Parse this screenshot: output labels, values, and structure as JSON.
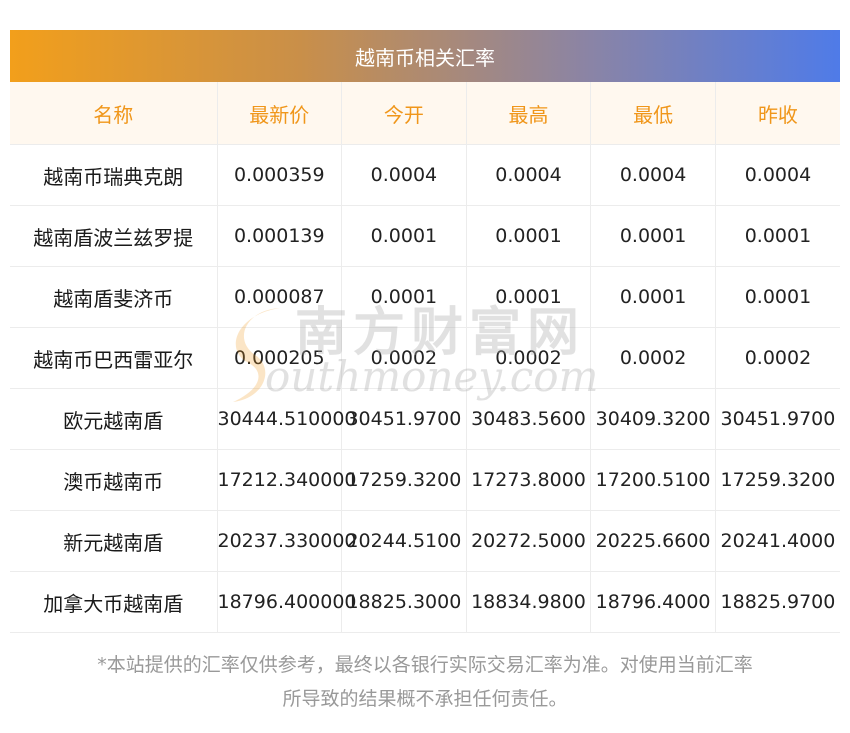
{
  "title": "越南币相关汇率",
  "columns": [
    "名称",
    "最新价",
    "今开",
    "最高",
    "最低",
    "昨收"
  ],
  "rows": [
    [
      "越南币瑞典克朗",
      "0.000359",
      "0.0004",
      "0.0004",
      "0.0004",
      "0.0004"
    ],
    [
      "越南盾波兰兹罗提",
      "0.000139",
      "0.0001",
      "0.0001",
      "0.0001",
      "0.0001"
    ],
    [
      "越南盾斐济币",
      "0.000087",
      "0.0001",
      "0.0001",
      "0.0001",
      "0.0001"
    ],
    [
      "越南币巴西雷亚尔",
      "0.000205",
      "0.0002",
      "0.0002",
      "0.0002",
      "0.0002"
    ],
    [
      "欧元越南盾",
      "30444.510000",
      "30451.9700",
      "30483.5600",
      "30409.3200",
      "30451.9700"
    ],
    [
      "澳币越南币",
      "17212.340000",
      "17259.3200",
      "17273.8000",
      "17200.5100",
      "17259.3200"
    ],
    [
      "新元越南盾",
      "20237.330000",
      "20244.5100",
      "20272.5000",
      "20225.6600",
      "20241.4000"
    ],
    [
      "加拿大币越南盾",
      "18796.400000",
      "18825.3000",
      "18834.9800",
      "18796.4000",
      "18825.9700"
    ]
  ],
  "watermark": {
    "cn": "南方财富网",
    "en": "outhmoney.com"
  },
  "footnote": {
    "line1": "*本站提供的汇率仅供参考，最终以各银行实际交易汇率为准。对使用当前汇率",
    "line2": "所导致的结果概不承担任何责任。"
  },
  "colors": {
    "header_text": "#f0961a",
    "gradient_start": "#f29f1b",
    "gradient_end": "#4f7be8"
  }
}
